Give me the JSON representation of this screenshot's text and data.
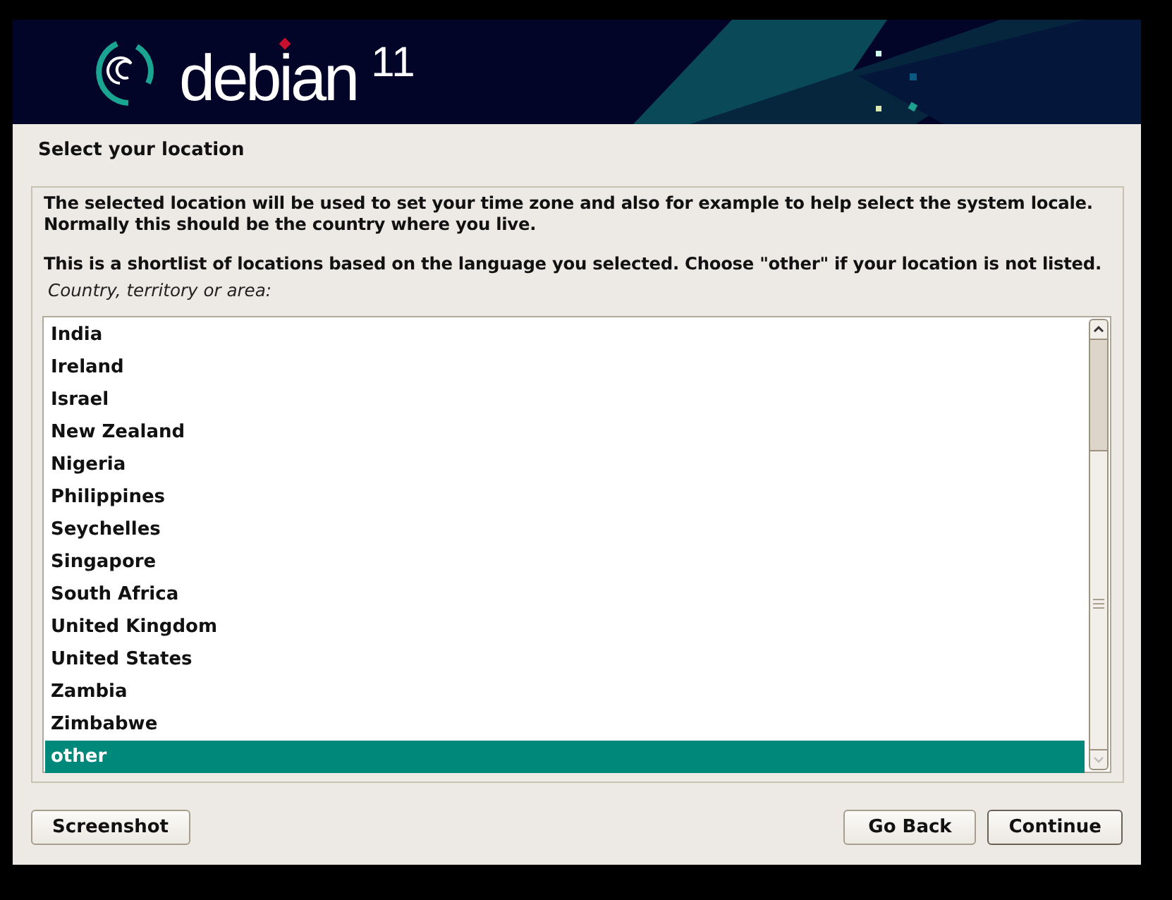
{
  "banner": {
    "logo_text": "debian",
    "version": "11"
  },
  "title": "Select your location",
  "description": [
    "The selected location will be used to set your time zone and also for example to help select the system locale. Normally this should be the country where you live.",
    "This is a shortlist of locations based on the language you selected. Choose \"other\" if your location is not listed."
  ],
  "list_label": "Country, territory or area:",
  "locations": [
    {
      "label": "India",
      "selected": false
    },
    {
      "label": "Ireland",
      "selected": false
    },
    {
      "label": "Israel",
      "selected": false
    },
    {
      "label": "New Zealand",
      "selected": false
    },
    {
      "label": "Nigeria",
      "selected": false
    },
    {
      "label": "Philippines",
      "selected": false
    },
    {
      "label": "Seychelles",
      "selected": false
    },
    {
      "label": "Singapore",
      "selected": false
    },
    {
      "label": "South Africa",
      "selected": false
    },
    {
      "label": "United Kingdom",
      "selected": false
    },
    {
      "label": "United States",
      "selected": false
    },
    {
      "label": "Zambia",
      "selected": false
    },
    {
      "label": "Zimbabwe",
      "selected": false
    },
    {
      "label": "other",
      "selected": true
    }
  ],
  "buttons": {
    "left": [
      "Screenshot"
    ],
    "right": [
      "Go Back",
      "Continue"
    ]
  }
}
